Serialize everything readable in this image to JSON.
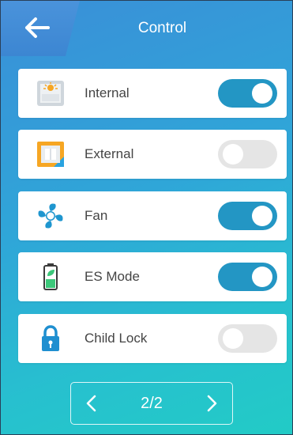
{
  "header": {
    "title": "Control",
    "back_icon": "arrow-left-icon"
  },
  "controls": [
    {
      "label": "Internal",
      "icon": "internal-heater-icon",
      "on": true
    },
    {
      "label": "External",
      "icon": "external-heater-icon",
      "on": false
    },
    {
      "label": "Fan",
      "icon": "fan-icon",
      "on": true
    },
    {
      "label": "ES Mode",
      "icon": "battery-leaf-icon",
      "on": true
    },
    {
      "label": "Child Lock",
      "icon": "lock-icon",
      "on": false
    }
  ],
  "pager": {
    "page_text": "2/2"
  },
  "colors": {
    "toggle_on": "#2396c4",
    "toggle_off": "#e5e5e5",
    "background_start": "#3a8fd8",
    "background_end": "#22cbc6"
  }
}
